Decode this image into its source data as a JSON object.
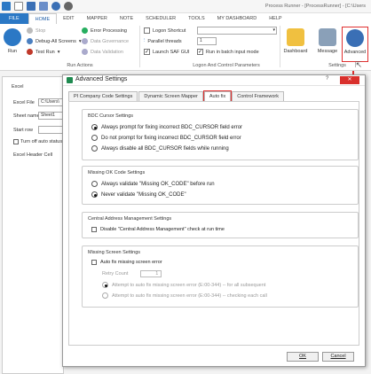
{
  "app": {
    "title": "Process Runner - [ProcessRunner] - [C:\\Users"
  },
  "ribbon_tabs": [
    "FILE",
    "HOME",
    "EDIT",
    "MAPPER",
    "NOTE",
    "SCHEDULER",
    "TOOLS",
    "MY DASHBOARD",
    "HELP"
  ],
  "run_actions": {
    "run": "Run",
    "stop": "Stop",
    "debug": "Debug-All Screens",
    "test_run": "Test Run",
    "error_processing": "Error Processing",
    "data_governance": "Data Governance",
    "data_validation": "Data Validation",
    "label": "Run Actions"
  },
  "logon": {
    "logon_shortcut": "Logon Shortcut",
    "parallel_threads": "Parallel threads",
    "launch_saf": "Launch SAF GUI",
    "batch_mode": "Run in batch input mode",
    "threads_value": "1",
    "label": "Logon And Control Parameters"
  },
  "settings": {
    "dashboard": "Dashboard",
    "message": "Message",
    "advanced": "Advanced",
    "label": "Settings"
  },
  "left_panel": {
    "section": "Excel",
    "file_label": "Excel File",
    "file_value": "C:\\Users\\",
    "sheet_label": "Sheet name",
    "sheet_value": "Sheet1",
    "start_label": "Start row",
    "turnoff": "Turn off auto status",
    "header_cell": "Excel Header Cell"
  },
  "dialog": {
    "title": "Advanced Settings",
    "help": "?",
    "tabs": [
      "PI Company Code Settings",
      "Dynamic Screen Mapper",
      "Auto fix",
      "Control Framework"
    ],
    "bdc": {
      "title": "BDC Cursor Settings",
      "options": [
        "Always prompt for fixing incorrect BDC_CURSOR field error",
        "Do not prompt for fixing incorrect BDC_CURSOR field error",
        "Always disable all BDC_CURSOR fields while running"
      ]
    },
    "okcode": {
      "title": "Missing OK Code Settings",
      "options": [
        "Always validate \"Missing OK_CODE\" before run",
        "Never validate \"Missing OK_CODE\""
      ]
    },
    "central": {
      "title": "Central Address Management Settings",
      "checkbox": "Disable \"Central Address Management\" check at run time"
    },
    "missing": {
      "title": "Missing Screen Settings",
      "checkbox": "Auto fix missing screen error",
      "retry_label": "Retry Count",
      "retry_value": "1",
      "options": [
        "Attempt to auto fix missing screen error (E:00-344) -- for all subsequent",
        "Attempt to auto fix missing screen error (E:00-344) -- checking each call"
      ]
    },
    "ok": "OK",
    "cancel": "Cancel"
  },
  "colors": {
    "accent": "#2b78c5",
    "highlight": "#e03030"
  }
}
